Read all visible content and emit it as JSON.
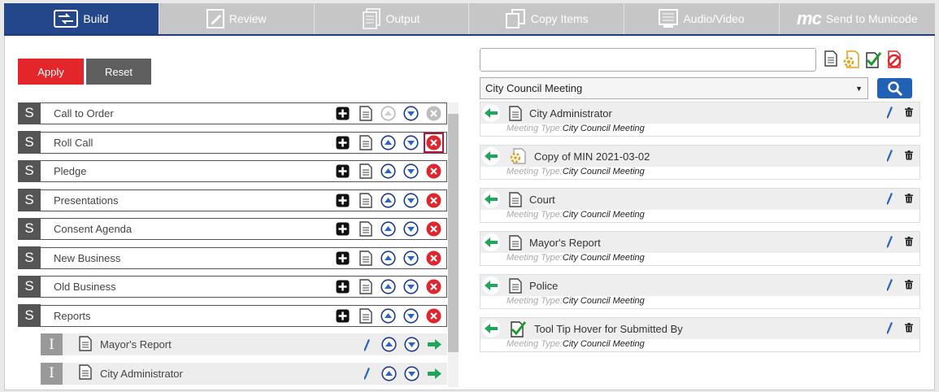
{
  "tabs": [
    {
      "label": "Build",
      "icon": "build-icon",
      "active": true
    },
    {
      "label": "Review",
      "icon": "review-icon"
    },
    {
      "label": "Output",
      "icon": "output-icon"
    },
    {
      "label": "Copy Items",
      "icon": "copy-items-icon"
    },
    {
      "label": "Audio/Video",
      "icon": "audio-video-icon"
    },
    {
      "label": "Send to Municode",
      "logo": "mc"
    }
  ],
  "actions": {
    "apply": "Apply",
    "reset": "Reset"
  },
  "sections": [
    {
      "badge": "S",
      "label": "Call to Order"
    },
    {
      "badge": "S",
      "label": "Roll Call"
    },
    {
      "badge": "S",
      "label": "Pledge"
    },
    {
      "badge": "S",
      "label": "Presentations"
    },
    {
      "badge": "S",
      "label": "Consent Agenda"
    },
    {
      "badge": "S",
      "label": "New Business"
    },
    {
      "badge": "S",
      "label": "Old Business"
    },
    {
      "badge": "S",
      "label": "Reports"
    }
  ],
  "subitems": [
    {
      "badge": "I",
      "label": "Mayor's Report"
    },
    {
      "badge": "I",
      "label": "City Administrator"
    }
  ],
  "search": {
    "value": ""
  },
  "filter": {
    "selected": "City Council Meeting"
  },
  "meta_label": "Meeting Type:",
  "items": [
    {
      "title": "City Administrator",
      "icon": "document-icon",
      "meeting_type": "City Council Meeting"
    },
    {
      "title": "Copy of MIN 2021-03-02",
      "icon": "gear-document-icon",
      "meeting_type": "City Council Meeting"
    },
    {
      "title": "Court",
      "icon": "document-icon",
      "meeting_type": "City Council Meeting"
    },
    {
      "title": "Mayor's Report",
      "icon": "document-icon",
      "meeting_type": "City Council Meeting"
    },
    {
      "title": "Police",
      "icon": "document-icon",
      "meeting_type": "City Council Meeting"
    },
    {
      "title": "Tool Tip Hover for Submitted By",
      "icon": "submitted-document-icon",
      "meeting_type": "City Council Meeting"
    }
  ],
  "colors": {
    "active_tab": "#23478a",
    "apply": "#e3252c",
    "reset": "#5f5f5f",
    "green_arrow": "#1fa65a",
    "delete_red": "#e0262c",
    "nav_blue": "#2a64c4"
  }
}
